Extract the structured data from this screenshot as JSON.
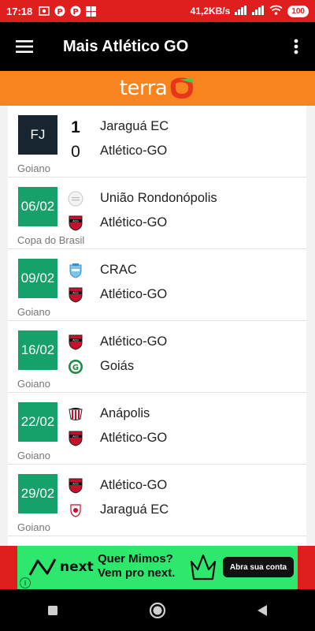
{
  "status_bar": {
    "time": "17:18",
    "network_speed": "41,2KB/s",
    "battery": "100"
  },
  "app_bar": {
    "title": "Mais Atlético GO"
  },
  "brand": {
    "name": "terra"
  },
  "matches": [
    {
      "tile": "FJ",
      "tile_state": "finished",
      "competition": "Goiano",
      "home": "Jaraguá EC",
      "away": "Atlético-GO",
      "home_score": "1",
      "away_score": "0",
      "home_crest": null,
      "away_crest": null
    },
    {
      "tile": "06/02",
      "tile_state": "scheduled",
      "competition": "Copa do Brasil",
      "home": "União Rondonópolis",
      "away": "Atlético-GO",
      "home_crest": "uniao-crest-icon",
      "away_crest": "atletico-go-crest-icon"
    },
    {
      "tile": "09/02",
      "tile_state": "scheduled",
      "competition": "Goiano",
      "home": "CRAC",
      "away": "Atlético-GO",
      "home_crest": "crac-crest-icon",
      "away_crest": "atletico-go-crest-icon"
    },
    {
      "tile": "16/02",
      "tile_state": "scheduled",
      "competition": "Goiano",
      "home": "Atlético-GO",
      "away": "Goiás",
      "home_crest": "atletico-go-crest-icon",
      "away_crest": "goias-crest-icon"
    },
    {
      "tile": "22/02",
      "tile_state": "scheduled",
      "competition": "Goiano",
      "home": "Anápolis",
      "away": "Atlético-GO",
      "home_crest": "anapolis-crest-icon",
      "away_crest": "atletico-go-crest-icon"
    },
    {
      "tile": "29/02",
      "tile_state": "scheduled",
      "competition": "Goiano",
      "home": "Atlético-GO",
      "away": "Jaraguá EC",
      "home_crest": "atletico-go-crest-icon",
      "away_crest": "jaragua-crest-icon"
    }
  ],
  "ad": {
    "logo_text": "next",
    "headline_1": "Quer Mimos?",
    "headline_2": "Vem pro next.",
    "cta": "Abra sua conta",
    "info": "i"
  },
  "colors": {
    "status_bar": "#e01e1e",
    "app_bar": "#000000",
    "brand_strip": "#f7841f",
    "date_tile": "#16a06a",
    "finished_tile": "#172530",
    "ad_background": "#2ee86e"
  }
}
